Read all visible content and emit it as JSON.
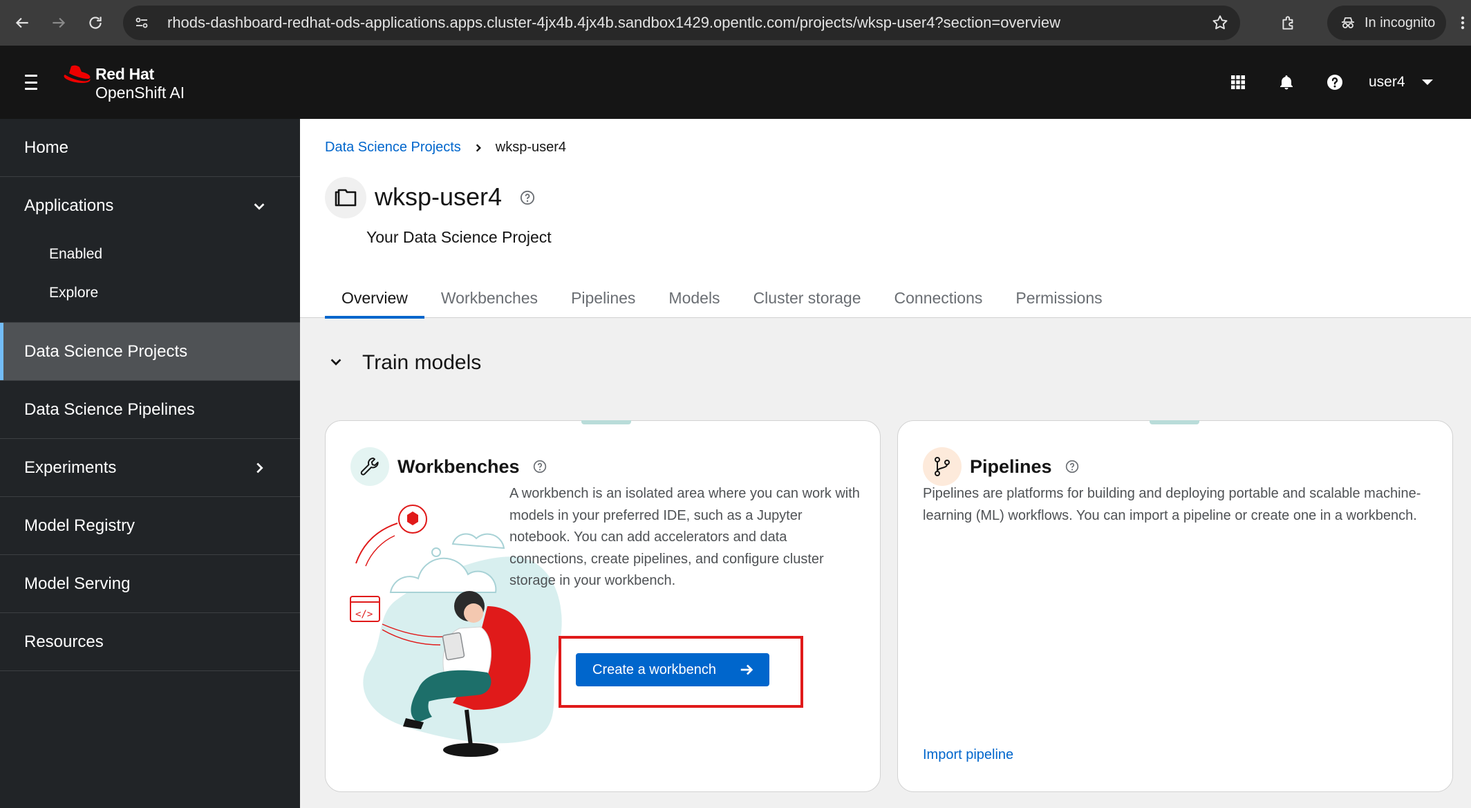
{
  "browser": {
    "url": "rhods-dashboard-redhat-ods-applications.apps.cluster-4jx4b.4jx4b.sandbox1429.opentlc.com/projects/wksp-user4?section=overview",
    "incognito_label": "In incognito",
    "icons": [
      "back-arrow-icon",
      "forward-arrow-icon",
      "reload-icon",
      "site-info-icon",
      "bookmark-star-icon",
      "extensions-icon",
      "incognito-icon",
      "kebab-menu-icon"
    ]
  },
  "masthead": {
    "brand_line1": "Red Hat",
    "brand_line2": "OpenShift AI",
    "username": "user4",
    "icons": [
      "hamburger-icon",
      "app-launcher-grid-icon",
      "notifications-bell-icon",
      "help-icon",
      "caret-down-icon"
    ],
    "colors": {
      "background": "#151515",
      "brand_red": "#ee0000"
    }
  },
  "sidebar": {
    "items": [
      {
        "label": "Home"
      },
      {
        "label": "Applications",
        "expanded": true,
        "children": [
          {
            "label": "Enabled"
          },
          {
            "label": "Explore"
          }
        ]
      },
      {
        "label": "Data Science Projects",
        "current": true
      },
      {
        "label": "Data Science Pipelines"
      },
      {
        "label": "Experiments",
        "expandable": true
      },
      {
        "label": "Model Registry"
      },
      {
        "label": "Model Serving"
      },
      {
        "label": "Resources"
      }
    ],
    "colors": {
      "background": "#212427",
      "current_background": "#4f5255",
      "current_indicator": "#73bcf7"
    }
  },
  "breadcrumb": {
    "link": "Data Science Projects",
    "current": "wksp-user4"
  },
  "project": {
    "title": "wksp-user4",
    "description": "Your Data Science Project"
  },
  "tabs": [
    {
      "label": "Overview",
      "active": true
    },
    {
      "label": "Workbenches"
    },
    {
      "label": "Pipelines"
    },
    {
      "label": "Models"
    },
    {
      "label": "Cluster storage"
    },
    {
      "label": "Connections"
    },
    {
      "label": "Permissions"
    }
  ],
  "section": {
    "title": "Train models",
    "expanded": true
  },
  "cards": {
    "workbenches": {
      "title": "Workbenches",
      "icon": "wrench-icon",
      "description": "A workbench is an isolated area where you can work with models in your preferred IDE, such as a Jupyter notebook. You can add accelerators and data connections, create pipelines, and configure cluster storage in your workbench.",
      "button": "Create a workbench",
      "highlighted": true
    },
    "pipelines": {
      "title": "Pipelines",
      "icon": "pipeline-branch-icon",
      "description": "Pipelines are platforms for building and deploying portable and scalable machine-learning (ML) workflows. You can import a pipeline or create one in a workbench.",
      "link": "Import pipeline"
    }
  },
  "colors": {
    "link": "#0066cc",
    "primary_button": "#0066cc",
    "highlight_annotation": "#e01a1a",
    "card_accent": "#b9dcd9"
  }
}
